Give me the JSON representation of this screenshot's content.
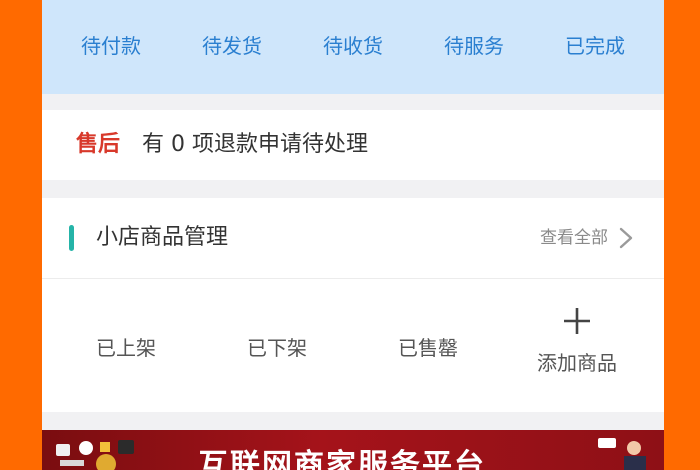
{
  "orders": {
    "tabs": [
      {
        "label": "待付款"
      },
      {
        "label": "待发货"
      },
      {
        "label": "待收货"
      },
      {
        "label": "待服务"
      },
      {
        "label": "已完成"
      }
    ]
  },
  "after_sales": {
    "label": "售后",
    "message": "有 0 项退款申请待处理"
  },
  "goods": {
    "title": "小店商品管理",
    "view_all": "查看全部",
    "items": [
      {
        "label": "已上架"
      },
      {
        "label": "已下架"
      },
      {
        "label": "已售罄"
      }
    ],
    "add_label": "添加商品"
  },
  "banner": {
    "title": "互联网商家服务平台"
  },
  "colors": {
    "background": "#ff6a00",
    "tab_text": "#2a7fd0",
    "after_sales_label": "#d8392b",
    "accent": "#25b4a8"
  }
}
